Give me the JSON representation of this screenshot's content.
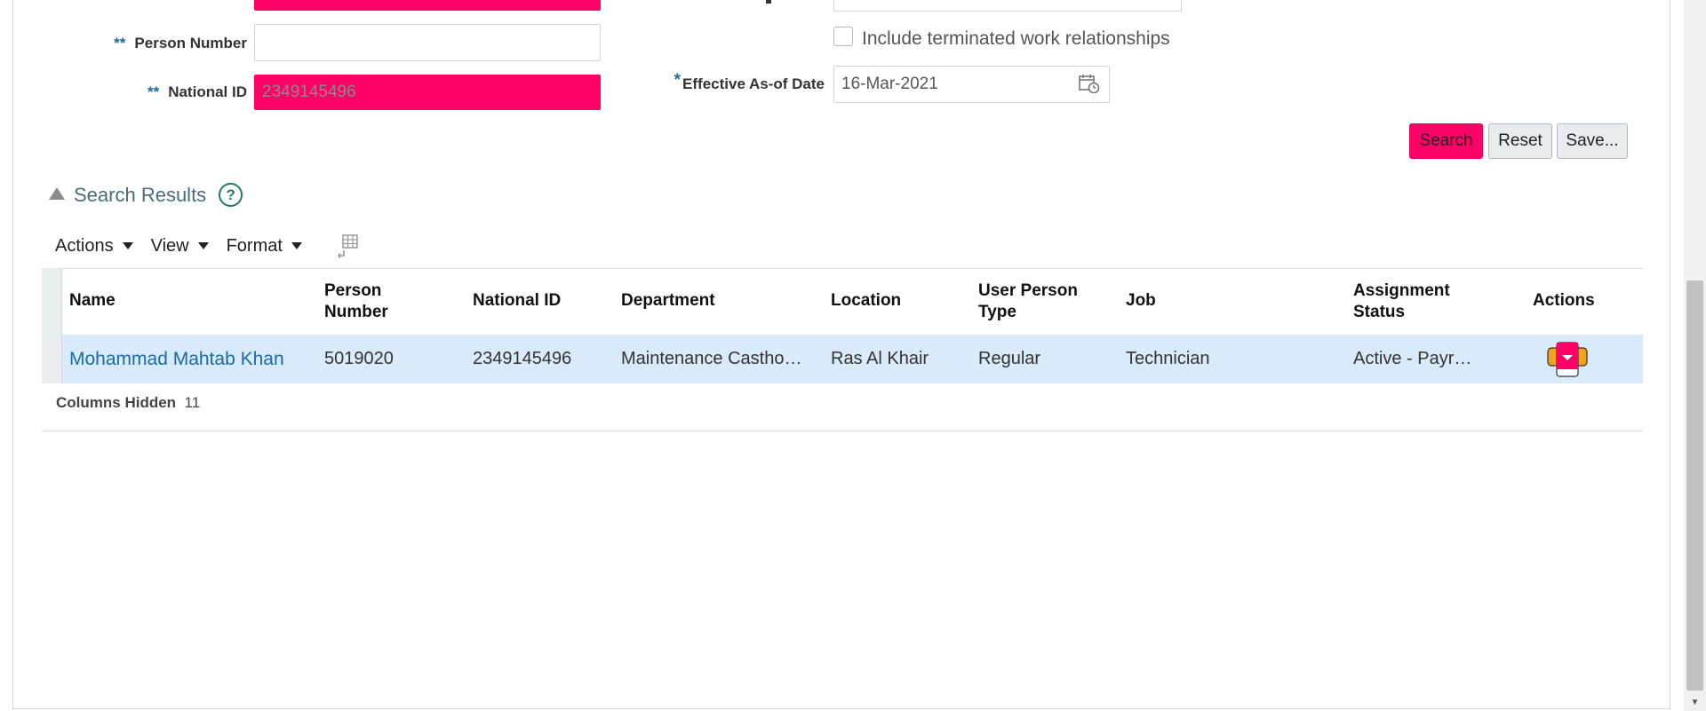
{
  "form": {
    "person_number_label": "Person Number",
    "person_number_value": "",
    "national_id_label": "National ID",
    "national_id_value": "2349145496",
    "required_marker": "**",
    "include_terminated_label": "Include terminated work relationships",
    "effective_date_star": "*",
    "effective_date_label": "Effective As-of Date",
    "effective_date_value": "16-Mar-2021"
  },
  "buttons": {
    "search": "Search",
    "reset": "Reset",
    "save": "Save..."
  },
  "search_results": {
    "title": "Search Results",
    "help": "?"
  },
  "toolbar": {
    "actions": "Actions",
    "view": "View",
    "format": "Format"
  },
  "table": {
    "headers": {
      "name": "Name",
      "person_number_1": "Person",
      "person_number_2": "Number",
      "national_id": "National ID",
      "department": "Department",
      "location": "Location",
      "user_person_type_1": "User Person",
      "user_person_type_2": "Type",
      "job": "Job",
      "assignment_status_1": "Assignment",
      "assignment_status_2": "Status",
      "actions": "Actions"
    },
    "rows": [
      {
        "name": "Mohammad Mahtab Khan",
        "person_number": "5019020",
        "national_id": "2349145496",
        "department": "Maintenance Castho…",
        "location": "Ras Al Khair",
        "user_person_type": "Regular",
        "job": "Technician",
        "assignment_status": "Active - Payr…"
      }
    ],
    "columns_hidden_label": "Columns Hidden",
    "columns_hidden_count": "11"
  },
  "colors": {
    "highlight": "#ff0066",
    "link": "#1a6ba8",
    "row_selected": "#d9eafa"
  }
}
